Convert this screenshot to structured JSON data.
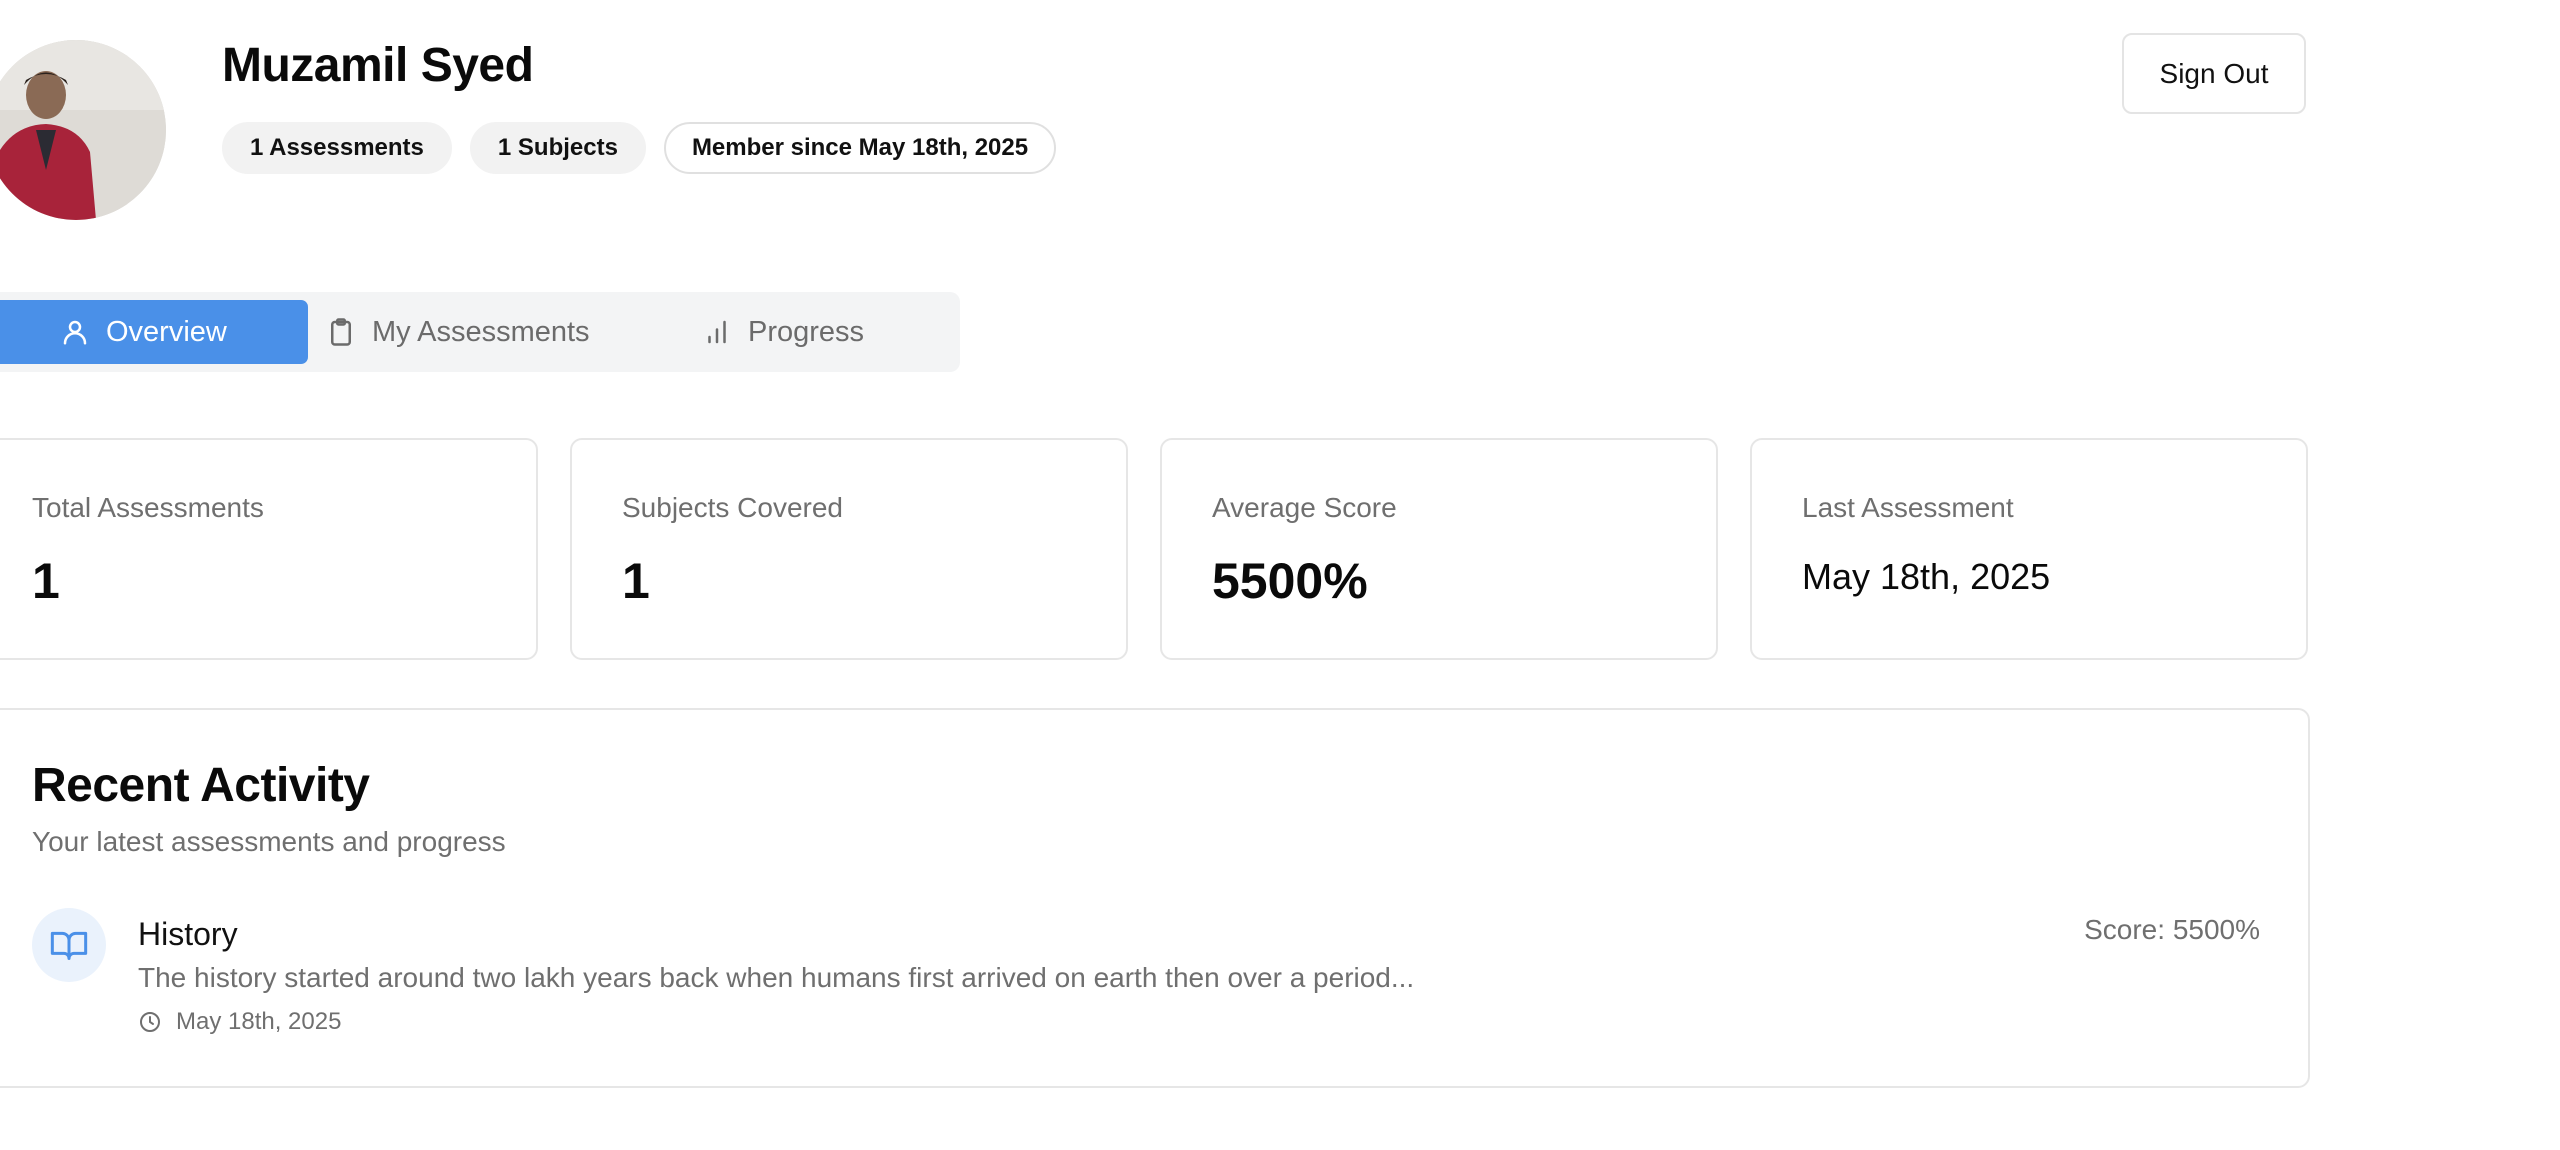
{
  "profile": {
    "name": "Muzamil Syed",
    "badges": {
      "assessments": "1 Assessments",
      "subjects": "1 Subjects",
      "member_since": "Member since May 18th, 2025"
    },
    "sign_out_label": "Sign Out"
  },
  "tabs": [
    {
      "label": "Overview",
      "icon": "user-icon",
      "active": true
    },
    {
      "label": "My Assessments",
      "icon": "clipboard-icon",
      "active": false
    },
    {
      "label": "Progress",
      "icon": "bar-chart-icon",
      "active": false
    }
  ],
  "stats": [
    {
      "label": "Total Assessments",
      "value": "1"
    },
    {
      "label": "Subjects Covered",
      "value": "1"
    },
    {
      "label": "Average Score",
      "value": "5500%"
    },
    {
      "label": "Last Assessment",
      "value": "May 18th, 2025"
    }
  ],
  "recent_activity": {
    "title": "Recent Activity",
    "subtitle": "Your latest assessments and progress",
    "items": [
      {
        "icon": "book-open-icon",
        "subject": "History",
        "description": "The history started around two lakh years back when humans first arrived on earth then over a period...",
        "date": "May 18th, 2025",
        "score": "Score: 5500%"
      }
    ]
  },
  "colors": {
    "accent": "#4a90e8",
    "icon_bg": "#eaf2fc",
    "muted_text": "#6f6f6f",
    "border": "#e6e6e6"
  }
}
